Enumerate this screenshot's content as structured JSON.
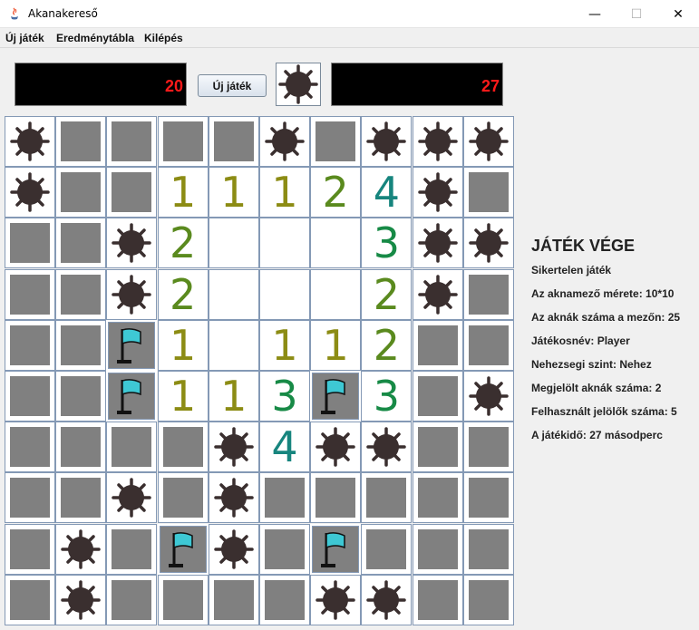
{
  "window": {
    "title": "Akanakereső",
    "minimize": "—",
    "maximize": "☐",
    "close": "✕"
  },
  "menu": [
    "Új játék",
    "Eredménytábla",
    "Kilépés"
  ],
  "toolbar": {
    "mines_left": "20",
    "new_game_label": "Új játék",
    "timer": "27"
  },
  "colors": {
    "one": "#8c8c14",
    "two": "#5a8a1e",
    "three": "#178a46",
    "four": "#17857e",
    "hidden": "#808080",
    "mine": "#3a2f2f",
    "flag": "#3ec8d4",
    "counter": "#ff1a1a"
  },
  "board": {
    "rows": [
      [
        "M",
        "H",
        "H",
        "H",
        "H",
        "M",
        "H",
        "M",
        "M",
        "M"
      ],
      [
        "M",
        "H",
        "H",
        "1",
        "1",
        "1",
        "2",
        "4",
        "M",
        "H"
      ],
      [
        "H",
        "H",
        "M",
        "2",
        "E",
        "E",
        "E",
        "3",
        "M",
        "M"
      ],
      [
        "H",
        "H",
        "M",
        "2",
        "E",
        "E",
        "E",
        "2",
        "M",
        "H"
      ],
      [
        "H",
        "H",
        "F",
        "1",
        "E",
        "1",
        "1",
        "2",
        "H",
        "H"
      ],
      [
        "H",
        "H",
        "F",
        "1",
        "1",
        "3",
        "F",
        "3",
        "H",
        "M"
      ],
      [
        "H",
        "H",
        "H",
        "H",
        "M",
        "4",
        "M",
        "M",
        "H",
        "H"
      ],
      [
        "H",
        "H",
        "M",
        "H",
        "M",
        "H",
        "H",
        "H",
        "H",
        "H"
      ],
      [
        "H",
        "M",
        "H",
        "F",
        "M",
        "H",
        "F",
        "H",
        "H",
        "H"
      ],
      [
        "H",
        "M",
        "H",
        "H",
        "H",
        "H",
        "M",
        "M",
        "H",
        "H"
      ]
    ]
  },
  "info": {
    "title": "JÁTÉK VÉGE",
    "lines": [
      "Sikertelen játék",
      "Az aknamező mérete: 10*10",
      "Az aknák száma a mezőn: 25",
      "Játékosnév: Player",
      "Nehezsegi szint: Nehez",
      "Megjelölt aknák száma: 2",
      "Felhasznált jelölők száma: 5",
      "A játékidő: 27 másodperc"
    ]
  }
}
